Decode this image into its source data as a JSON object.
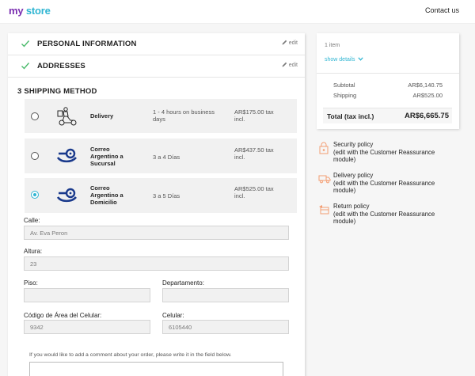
{
  "header": {
    "logo_my": "my",
    "logo_store": "store",
    "contact": "Contact us"
  },
  "steps": {
    "personal": {
      "title": "PERSONAL INFORMATION",
      "edit": "edit"
    },
    "addresses": {
      "title": "ADDRESSES",
      "edit": "edit"
    },
    "shipping": {
      "title": "3 SHIPPING METHOD"
    }
  },
  "carriers": [
    {
      "name": "Delivery",
      "delay": "1 - 4 hours on business days",
      "price": "AR$175.00 tax incl.",
      "selected": false,
      "icon": "delivery-courier-icon"
    },
    {
      "name": "Correo Argentino a Sucursal",
      "delay": "3 a 4 Días",
      "price": "AR$437.50 tax incl.",
      "selected": false,
      "icon": "correo-argentino-logo"
    },
    {
      "name": "Correo Argentino a Domicilio",
      "delay": "3 a 5 Días",
      "price": "AR$525.00 tax incl.",
      "selected": true,
      "icon": "correo-argentino-logo"
    }
  ],
  "form": {
    "calle": {
      "label": "Calle:",
      "value": "Av. Eva Peron"
    },
    "altura": {
      "label": "Altura:",
      "value": "23"
    },
    "piso": {
      "label": "Piso:",
      "value": ""
    },
    "departamento": {
      "label": "Departamento:",
      "value": ""
    },
    "codigo_area": {
      "label": "Código de Área del Celular:",
      "value": "9342"
    },
    "celular": {
      "label": "Celular:",
      "value": "6105440"
    }
  },
  "comment": {
    "label": "If you would like to add a comment about your order, please write it in the field below.",
    "value": ""
  },
  "summary": {
    "items": "1 item",
    "show_details": "show details",
    "subtotal_label": "Subtotal",
    "subtotal_value": "AR$6,140.75",
    "shipping_label": "Shipping",
    "shipping_value": "AR$525.00",
    "total_label": "Total (tax incl.)",
    "total_value": "AR$6,665.75"
  },
  "reassurance": [
    {
      "title": "Security policy",
      "subtitle": "(edit with the Customer Reassurance module)",
      "icon": "security-shield-icon"
    },
    {
      "title": "Delivery policy",
      "subtitle": "(edit with the Customer Reassurance module)",
      "icon": "delivery-truck-icon"
    },
    {
      "title": "Return policy",
      "subtitle": "(edit with the Customer Reassurance module)",
      "icon": "return-icon"
    }
  ],
  "colors": {
    "accent": "#2fb5d2",
    "brand_purple": "#7a2eb0",
    "check_green": "#4cbb6c",
    "reassurance_orange": "#f39d72",
    "correo_blue": "#1a3a8c"
  }
}
